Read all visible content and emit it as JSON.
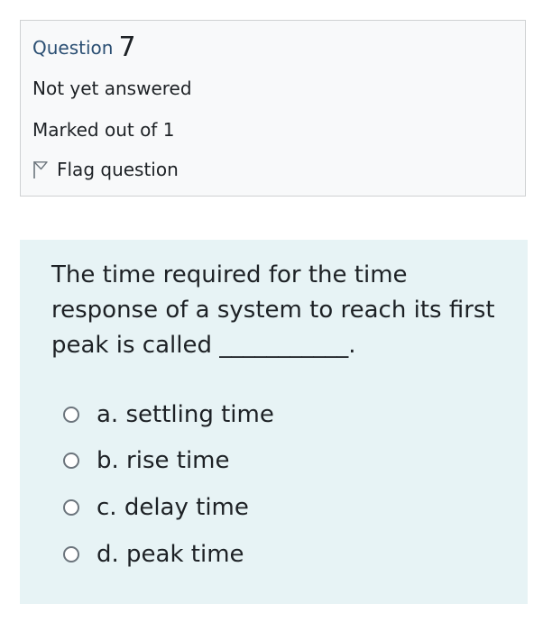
{
  "info": {
    "question_label": "Question",
    "question_number": "7",
    "state": "Not yet answered",
    "grade": "Marked out of 1",
    "flag_label": "Flag question",
    "flag_icon": "flag-outline-icon"
  },
  "question": {
    "text_lines": [
      "The time required for the time",
      "response of a system to reach its first",
      "peak is called ___________."
    ],
    "answers": [
      {
        "label": "a. settling time",
        "selected": false
      },
      {
        "label": "b. rise time",
        "selected": false
      },
      {
        "label": "c. delay time",
        "selected": false
      },
      {
        "label": "d. peak time",
        "selected": false
      }
    ]
  },
  "colors": {
    "info_background": "#f8f9fa",
    "info_border": "#cfd1d3",
    "question_label": "#2b4f73",
    "content_background": "#e7f3f5",
    "radio_border": "#6c757d"
  }
}
